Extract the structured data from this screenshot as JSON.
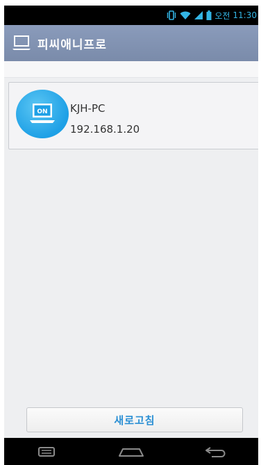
{
  "status_bar": {
    "ampm": "오전",
    "time": "11:30"
  },
  "app_bar": {
    "title": "피씨애니프로"
  },
  "devices": [
    {
      "name": "KJH-PC",
      "ip": "192.168.1.20",
      "status_label": "ON"
    }
  ],
  "refresh_label": "새로고침",
  "colors": {
    "accent": "#33b5e5",
    "action_bar": "#8294b4",
    "device_icon": "#1ea0e6",
    "refresh_text": "#2a8fd4"
  },
  "icons": {
    "status": [
      "vibrate-icon",
      "wifi-icon",
      "signal-icon",
      "battery-icon"
    ],
    "app": "laptop-icon",
    "nav": [
      "recent-apps-icon",
      "home-icon",
      "back-icon"
    ]
  }
}
